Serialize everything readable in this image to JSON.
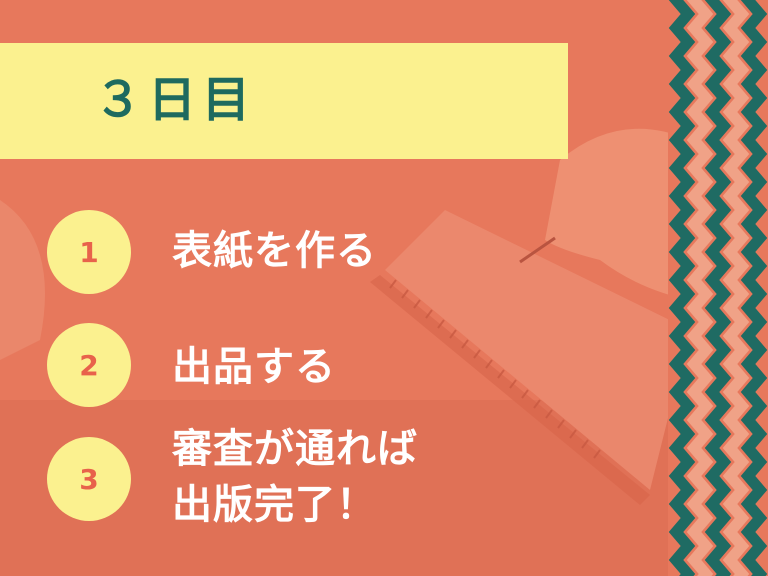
{
  "title": "３日目",
  "steps": [
    {
      "number": "1",
      "text": "表紙を作る"
    },
    {
      "number": "2",
      "text": "出品する"
    },
    {
      "number": "3",
      "text_line1": "審査が通れば",
      "text_line2": "出版完了！"
    }
  ],
  "colors": {
    "background": "#e7785c",
    "banner": "#fbf18f",
    "title_text": "#1e6a5f",
    "number_text": "#e8624b",
    "zigzag_dark": "#1f6b63",
    "zigzag_light": "#f0a287"
  },
  "decoration": {
    "background_image": "hand-writing-in-spiral-notebook",
    "right_border": "zigzag-chevron-pattern"
  }
}
